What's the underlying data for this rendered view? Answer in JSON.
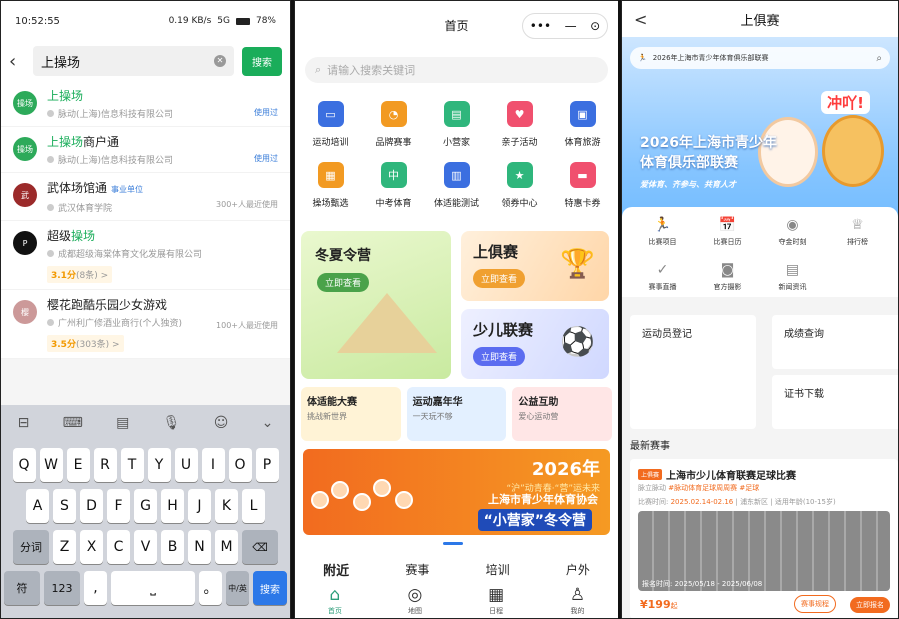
{
  "left": {
    "status": {
      "time": "10:52:55",
      "net": "0.19 KB/s",
      "signal": "5G",
      "battery": "78%"
    },
    "search": {
      "query": "上操场",
      "button": "搜索"
    },
    "results": [
      {
        "name_hl": "上操场",
        "name_rest": "",
        "sub": "脉动(上海)信息科技有限公司",
        "tag": "使用过",
        "logo_text": "操场",
        "color": "#2daa5a"
      },
      {
        "name_hl": "上操场",
        "name_rest": "商户通",
        "sub": "脉动(上海)信息科技有限公司",
        "tag": "使用过",
        "logo_text": "操场",
        "color": "#2daa5a"
      },
      {
        "name_hl": "",
        "name_rest": "武体场馆通",
        "badge": "事业单位",
        "sub": "武汉体育学院",
        "tag": "300+人最近使用",
        "logo_text": "武",
        "color": "#9b2a2a"
      },
      {
        "name_hl": "操场",
        "name_rest_pre": "超级",
        "sub": "成都超级海棠体育文化发展有限公司",
        "rating": "3.1分",
        "rating_count": "(8条) >",
        "logo_text": "P",
        "color": "#111"
      },
      {
        "name_hl": "",
        "name_rest": "樱花跑酷乐园少女游戏",
        "sub": "广州利广修酒业商行(个人独资)",
        "tag": "100+人最近使用",
        "rating": "3.5分",
        "rating_count": "(303条) >",
        "logo_text": "樱",
        "color": "#c99"
      }
    ],
    "keyboard": {
      "toolbar": [
        "⊟",
        "⌨",
        "▤",
        "🎙",
        "☺",
        "⌄"
      ],
      "row1": [
        "Q",
        "W",
        "E",
        "R",
        "T",
        "Y",
        "U",
        "I",
        "O",
        "P"
      ],
      "row2": [
        "A",
        "S",
        "D",
        "F",
        "G",
        "H",
        "J",
        "K",
        "L"
      ],
      "row3_left": "分词",
      "row3": [
        "Z",
        "X",
        "C",
        "V",
        "B",
        "N",
        "M"
      ],
      "del": "⌫",
      "sym": "符",
      "num": "123",
      "comma": ",",
      "space": "⎵",
      "dot": "。",
      "lang": "中/英",
      "go": "搜索"
    }
  },
  "mid": {
    "title": "首页",
    "capsule": [
      "•••",
      "—",
      "⊙"
    ],
    "search_placeholder": "请输入搜索关键词",
    "grid": [
      {
        "label": "运动培训",
        "icon": "▭",
        "color": "#3b6fe0"
      },
      {
        "label": "品牌赛事",
        "icon": "◔",
        "color": "#f29a22"
      },
      {
        "label": "小营家",
        "icon": "▤",
        "color": "#2fb67c"
      },
      {
        "label": "亲子活动",
        "icon": "♥",
        "color": "#f0506e"
      },
      {
        "label": "体育旅游",
        "icon": "▣",
        "color": "#3b6fe0"
      },
      {
        "label": "操场甄选",
        "icon": "▦",
        "color": "#f29a22"
      },
      {
        "label": "中考体育",
        "icon": "中",
        "color": "#2fb67c"
      },
      {
        "label": "体适能测试",
        "icon": "▥",
        "color": "#3b6fe0"
      },
      {
        "label": "领券中心",
        "icon": "★",
        "color": "#2fb67c"
      },
      {
        "label": "特惠卡券",
        "icon": "▬",
        "color": "#f0506e"
      }
    ],
    "cards": {
      "winter": {
        "title": "冬夏令营",
        "btn": "立即查看"
      },
      "league": {
        "title": "上俱赛",
        "btn": "立即查看"
      },
      "kids": {
        "title": "少儿联赛",
        "btn": "立即查看"
      }
    },
    "row3": [
      {
        "title": "体适能大赛",
        "sub": "挑战新世界",
        "bg": "#fff3d6"
      },
      {
        "title": "运动嘉年华",
        "sub": "一天玩不够",
        "bg": "#e3f0ff"
      },
      {
        "title": "公益互助",
        "sub": "爱心运动营",
        "bg": "#ffe6e6"
      }
    ],
    "banner": {
      "year": "2026年",
      "slogan": "“沪”动青春·“营”运未来",
      "org": "上海市青少年体育协会",
      "camp": "“小营家”冬令营"
    },
    "tabs": [
      "附近",
      "赛事",
      "培训",
      "户外"
    ],
    "nav": [
      {
        "label": "首页",
        "icon": "⌂"
      },
      {
        "label": "地图",
        "icon": "◎"
      },
      {
        "label": "日程",
        "icon": "▦"
      },
      {
        "label": "我的",
        "icon": "♙"
      }
    ]
  },
  "right": {
    "title": "上俱赛",
    "back": "<",
    "search_text": "2026年上海市青少年体育俱乐部联赛",
    "hero": {
      "title_line1": "2026年上海市青少年",
      "title_line2": "体育俱乐部联赛",
      "slogan": "爱体育、齐参与、共育人才",
      "badge": "冲吖!"
    },
    "menu": [
      {
        "label": "比赛项目",
        "icon": "🏃"
      },
      {
        "label": "比赛日历",
        "icon": "📅"
      },
      {
        "label": "夺金时刻",
        "icon": "◉"
      },
      {
        "label": "排行榜",
        "icon": "♕"
      },
      {
        "label": "赛事直播",
        "icon": "✓"
      },
      {
        "label": "官方摄影",
        "icon": "◙"
      },
      {
        "label": "新闻资讯",
        "icon": "▤"
      }
    ],
    "boxes": {
      "athlete": "运动员登记",
      "score": "成绩查询",
      "cert": "证书下载"
    },
    "latest_title": "最新赛事",
    "event": {
      "pill": "上俱赛",
      "title": "上海市少儿体育联赛足球比赛",
      "org": "脉立脉动",
      "tags": "#脉动体育足球周周赛 #足球",
      "time_label": "比赛时间:",
      "time": "2025.02.14-02.16",
      "area": "浦东新区",
      "age": "适用年龄(10-15岁)",
      "signup": "报名时间: 2025/05/18 - 2025/06/08",
      "price": "¥199",
      "price_unit": "起",
      "btn_rules": "赛事规程",
      "btn_signup": "立即报名"
    }
  }
}
